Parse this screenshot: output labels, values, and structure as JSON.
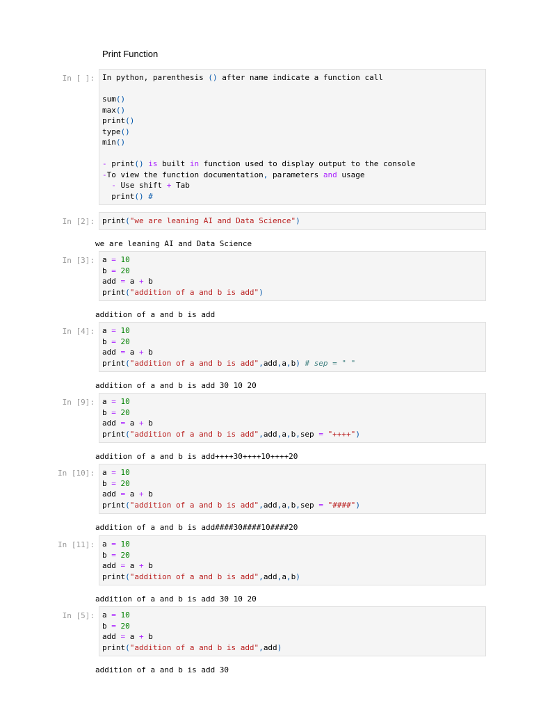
{
  "heading": "Print Function",
  "cells": [
    {
      "prompt": "In [ ]:",
      "lines": [
        [
          [
            "t",
            "In python, parenthesis "
          ],
          [
            "blue",
            "()"
          ],
          [
            "t",
            " after name indicate a function call"
          ]
        ],
        [
          [
            "t",
            ""
          ]
        ],
        [
          [
            "t",
            "sum"
          ],
          [
            "blue",
            "()"
          ]
        ],
        [
          [
            "t",
            "max"
          ],
          [
            "blue",
            "()"
          ]
        ],
        [
          [
            "t",
            "print"
          ],
          [
            "blue",
            "()"
          ]
        ],
        [
          [
            "t",
            "type"
          ],
          [
            "blue",
            "()"
          ]
        ],
        [
          [
            "t",
            "min"
          ],
          [
            "blue",
            "()"
          ]
        ],
        [
          [
            "t",
            ""
          ]
        ],
        [
          [
            "purple",
            "- "
          ],
          [
            "t",
            "print"
          ],
          [
            "blue",
            "()"
          ],
          [
            "t",
            " "
          ],
          [
            "purple",
            "is"
          ],
          [
            "t",
            " built "
          ],
          [
            "purple",
            "in"
          ],
          [
            "t",
            " function used to display output to the console"
          ]
        ],
        [
          [
            "purple",
            "-"
          ],
          [
            "t",
            "To view the function documentation"
          ],
          [
            "blue",
            ","
          ],
          [
            "t",
            " parameters "
          ],
          [
            "purple",
            "and"
          ],
          [
            "t",
            " usage"
          ]
        ],
        [
          [
            "t",
            "  "
          ],
          [
            "purple",
            "-"
          ],
          [
            "t",
            " Use shift "
          ],
          [
            "purple",
            "+"
          ],
          [
            "t",
            " Tab"
          ]
        ],
        [
          [
            "t",
            "  print"
          ],
          [
            "blue",
            "()"
          ],
          [
            "t",
            " "
          ],
          [
            "blue",
            "#"
          ]
        ]
      ],
      "output": ""
    },
    {
      "prompt": "In [2]:",
      "lines": [
        [
          [
            "t",
            "print"
          ],
          [
            "blue",
            "("
          ],
          [
            "red",
            "\"we are leaning AI and Data Science\""
          ],
          [
            "blue",
            ")"
          ]
        ]
      ],
      "output": "we are leaning AI and Data Science"
    },
    {
      "prompt": "In [3]:",
      "lines": [
        [
          [
            "t",
            "a "
          ],
          [
            "purple",
            "="
          ],
          [
            "t",
            " "
          ],
          [
            "num",
            "10"
          ]
        ],
        [
          [
            "t",
            "b "
          ],
          [
            "purple",
            "="
          ],
          [
            "t",
            " "
          ],
          [
            "num",
            "20"
          ]
        ],
        [
          [
            "t",
            "add "
          ],
          [
            "purple",
            "="
          ],
          [
            "t",
            " a "
          ],
          [
            "purple",
            "+"
          ],
          [
            "t",
            " b"
          ]
        ],
        [
          [
            "t",
            "print"
          ],
          [
            "blue",
            "("
          ],
          [
            "red",
            "\"addition of a and b is add\""
          ],
          [
            "blue",
            ")"
          ]
        ]
      ],
      "output": "addition of a and b is add"
    },
    {
      "prompt": "In [4]:",
      "lines": [
        [
          [
            "t",
            "a "
          ],
          [
            "purple",
            "="
          ],
          [
            "t",
            " "
          ],
          [
            "num",
            "10"
          ]
        ],
        [
          [
            "t",
            "b "
          ],
          [
            "purple",
            "="
          ],
          [
            "t",
            " "
          ],
          [
            "num",
            "20"
          ]
        ],
        [
          [
            "t",
            "add "
          ],
          [
            "purple",
            "="
          ],
          [
            "t",
            " a "
          ],
          [
            "purple",
            "+"
          ],
          [
            "t",
            " b"
          ]
        ],
        [
          [
            "t",
            "print"
          ],
          [
            "blue",
            "("
          ],
          [
            "red",
            "\"addition of a and b is add\""
          ],
          [
            "blue",
            ","
          ],
          [
            "t",
            "add"
          ],
          [
            "blue",
            ","
          ],
          [
            "t",
            "a"
          ],
          [
            "blue",
            ","
          ],
          [
            "t",
            "b"
          ],
          [
            "blue",
            ")"
          ],
          [
            "t",
            " "
          ],
          [
            "c",
            "# sep = \" \""
          ]
        ]
      ],
      "output": "addition of a and b is add 30 10 20"
    },
    {
      "prompt": "In [9]:",
      "lines": [
        [
          [
            "t",
            "a "
          ],
          [
            "purple",
            "="
          ],
          [
            "t",
            " "
          ],
          [
            "num",
            "10"
          ]
        ],
        [
          [
            "t",
            "b "
          ],
          [
            "purple",
            "="
          ],
          [
            "t",
            " "
          ],
          [
            "num",
            "20"
          ]
        ],
        [
          [
            "t",
            "add "
          ],
          [
            "purple",
            "="
          ],
          [
            "t",
            " a "
          ],
          [
            "purple",
            "+"
          ],
          [
            "t",
            " b"
          ]
        ],
        [
          [
            "t",
            "print"
          ],
          [
            "blue",
            "("
          ],
          [
            "red",
            "\"addition of a and b is add\""
          ],
          [
            "blue",
            ","
          ],
          [
            "t",
            "add"
          ],
          [
            "blue",
            ","
          ],
          [
            "t",
            "a"
          ],
          [
            "blue",
            ","
          ],
          [
            "t",
            "b"
          ],
          [
            "blue",
            ","
          ],
          [
            "t",
            "sep "
          ],
          [
            "purple",
            "="
          ],
          [
            "t",
            " "
          ],
          [
            "red",
            "\"++++\""
          ],
          [
            "blue",
            ")"
          ]
        ]
      ],
      "output": "addition of a and b is add++++30++++10++++20"
    },
    {
      "prompt": "In [10]:",
      "lines": [
        [
          [
            "t",
            "a "
          ],
          [
            "purple",
            "="
          ],
          [
            "t",
            " "
          ],
          [
            "num",
            "10"
          ]
        ],
        [
          [
            "t",
            "b "
          ],
          [
            "purple",
            "="
          ],
          [
            "t",
            " "
          ],
          [
            "num",
            "20"
          ]
        ],
        [
          [
            "t",
            "add "
          ],
          [
            "purple",
            "="
          ],
          [
            "t",
            " a "
          ],
          [
            "purple",
            "+"
          ],
          [
            "t",
            " b"
          ]
        ],
        [
          [
            "t",
            "print"
          ],
          [
            "blue",
            "("
          ],
          [
            "red",
            "\"addition of a and b is add\""
          ],
          [
            "blue",
            ","
          ],
          [
            "t",
            "add"
          ],
          [
            "blue",
            ","
          ],
          [
            "t",
            "a"
          ],
          [
            "blue",
            ","
          ],
          [
            "t",
            "b"
          ],
          [
            "blue",
            ","
          ],
          [
            "t",
            "sep "
          ],
          [
            "purple",
            "="
          ],
          [
            "t",
            " "
          ],
          [
            "red",
            "\"####\""
          ],
          [
            "blue",
            ")"
          ]
        ]
      ],
      "output": "addition of a and b is add####30####10####20"
    },
    {
      "prompt": "In [11]:",
      "lines": [
        [
          [
            "t",
            "a "
          ],
          [
            "purple",
            "="
          ],
          [
            "t",
            " "
          ],
          [
            "num",
            "10"
          ]
        ],
        [
          [
            "t",
            "b "
          ],
          [
            "purple",
            "="
          ],
          [
            "t",
            " "
          ],
          [
            "num",
            "20"
          ]
        ],
        [
          [
            "t",
            "add "
          ],
          [
            "purple",
            "="
          ],
          [
            "t",
            " a "
          ],
          [
            "purple",
            "+"
          ],
          [
            "t",
            " b"
          ]
        ],
        [
          [
            "t",
            "print"
          ],
          [
            "blue",
            "("
          ],
          [
            "red",
            "\"addition of a and b is add\""
          ],
          [
            "blue",
            ","
          ],
          [
            "t",
            "add"
          ],
          [
            "blue",
            ","
          ],
          [
            "t",
            "a"
          ],
          [
            "blue",
            ","
          ],
          [
            "t",
            "b"
          ],
          [
            "blue",
            ")"
          ]
        ]
      ],
      "output": "addition of a and b is add 30 10 20"
    },
    {
      "prompt": "In [5]:",
      "lines": [
        [
          [
            "t",
            "a "
          ],
          [
            "purple",
            "="
          ],
          [
            "t",
            " "
          ],
          [
            "num",
            "10"
          ]
        ],
        [
          [
            "t",
            "b "
          ],
          [
            "purple",
            "="
          ],
          [
            "t",
            " "
          ],
          [
            "num",
            "20"
          ]
        ],
        [
          [
            "t",
            "add "
          ],
          [
            "purple",
            "="
          ],
          [
            "t",
            " a "
          ],
          [
            "purple",
            "+"
          ],
          [
            "t",
            " b"
          ]
        ],
        [
          [
            "t",
            "print"
          ],
          [
            "blue",
            "("
          ],
          [
            "red",
            "\"addition of a and b is add\""
          ],
          [
            "blue",
            ","
          ],
          [
            "t",
            "add"
          ],
          [
            "blue",
            ")"
          ]
        ]
      ],
      "output": "addition of a and b is add 30"
    }
  ]
}
